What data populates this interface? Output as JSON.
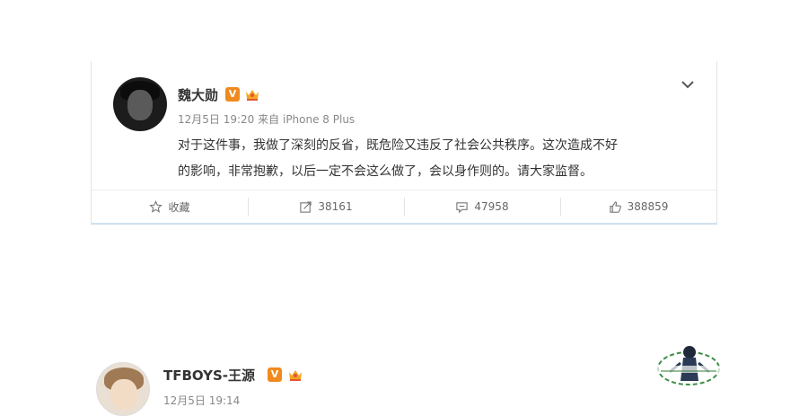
{
  "post1": {
    "username": "魏大勋",
    "verified_badge": "V",
    "date": "12月5日 19:20",
    "source_prefix": "来自",
    "device": "iPhone 8 Plus",
    "text_line1": "对于这件事，我做了深刻的反省，既危险又违反了社会公共秩序。这次造成不好",
    "text_line2": "的影响，非常抱歉，以后一定不会这么做了，会以身作则的。请大家监督。",
    "actions": {
      "favorite_label": "收藏",
      "repost_count": "38161",
      "comment_count": "47958",
      "like_count": "388859"
    },
    "icons": [
      "star-icon",
      "repost-icon",
      "comment-icon",
      "like-icon",
      "chevron-down-icon"
    ]
  },
  "post2": {
    "username": "TFBOYS-王源",
    "verified_badge": "V",
    "date": "12月5日 19:14"
  },
  "colors": {
    "badge_orange": "#f08a1e",
    "card_bottom_border": "#cfe0ee",
    "text_gray": "#888888"
  }
}
